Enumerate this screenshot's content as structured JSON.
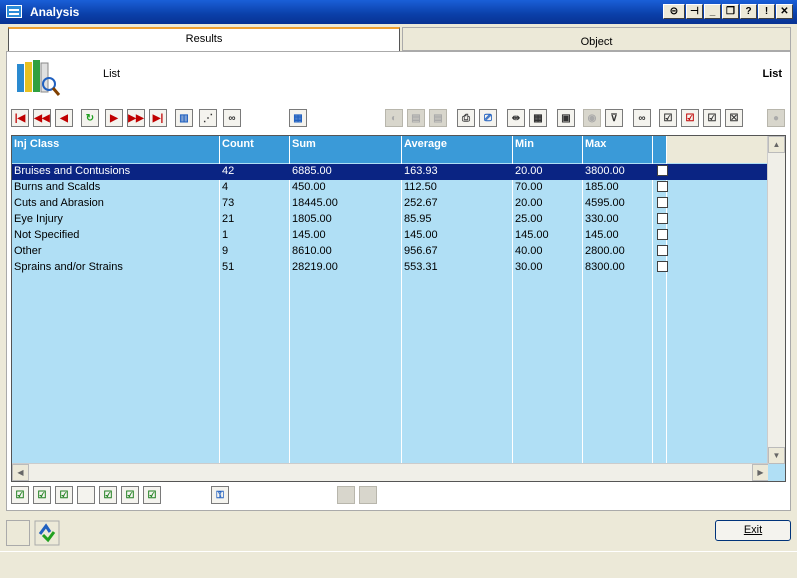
{
  "window": {
    "title": "Analysis"
  },
  "title_buttons": [
    "⊝",
    "⊣",
    "_",
    "❐",
    "?",
    "!",
    "✕"
  ],
  "tabs": [
    {
      "label": "Results"
    },
    {
      "label": "Object"
    }
  ],
  "panel": {
    "left_label": "List",
    "right_label": "List"
  },
  "toolbar_icons": [
    "first-record-icon",
    "prev-page-icon",
    "prev-record-icon",
    "refresh-icon",
    "next-record-icon",
    "next-page-icon",
    "last-record-icon",
    "chart-icon",
    "wand-icon",
    "link-icon",
    "spreadsheet-icon",
    "lightbulb-icon",
    "copy-icon",
    "paste-icon",
    "printer-icon",
    "print-preview-icon",
    "columns-icon",
    "table-icon",
    "export-icon",
    "filter-icon",
    "filter-apply-icon",
    "binoculars-icon",
    "check-edit-icon",
    "check-export-icon",
    "check-filter-icon",
    "check-delete-icon",
    "settings-icon"
  ],
  "grid": {
    "columns": [
      "Inj Class",
      "Count",
      "Sum",
      "Average",
      "Min",
      "Max"
    ],
    "rows": [
      {
        "inj_class": "Bruises and Contusions",
        "count": "42",
        "sum": "6885.00",
        "average": "163.93",
        "min": "20.00",
        "max": "3800.00",
        "selected": true
      },
      {
        "inj_class": "Burns and Scalds",
        "count": "4",
        "sum": "450.00",
        "average": "112.50",
        "min": "70.00",
        "max": "185.00",
        "selected": false
      },
      {
        "inj_class": "Cuts and Abrasion",
        "count": "73",
        "sum": "18445.00",
        "average": "252.67",
        "min": "20.00",
        "max": "4595.00",
        "selected": false
      },
      {
        "inj_class": "Eye Injury",
        "count": "21",
        "sum": "1805.00",
        "average": "85.95",
        "min": "25.00",
        "max": "330.00",
        "selected": false
      },
      {
        "inj_class": "Not Specified",
        "count": "1",
        "sum": "145.00",
        "average": "145.00",
        "min": "145.00",
        "max": "145.00",
        "selected": false
      },
      {
        "inj_class": "Other",
        "count": "9",
        "sum": "8610.00",
        "average": "956.67",
        "min": "40.00",
        "max": "2800.00",
        "selected": false
      },
      {
        "inj_class": "Sprains and/or Strains",
        "count": "51",
        "sum": "28219.00",
        "average": "553.31",
        "min": "30.00",
        "max": "8300.00",
        "selected": false
      }
    ]
  },
  "exit_button": {
    "label": "Exit"
  },
  "colors": {
    "title_bar": "#0a3fa8",
    "header": "#3a9ad8",
    "grid_bg": "#b0dff5",
    "selection": "#0a2483"
  }
}
